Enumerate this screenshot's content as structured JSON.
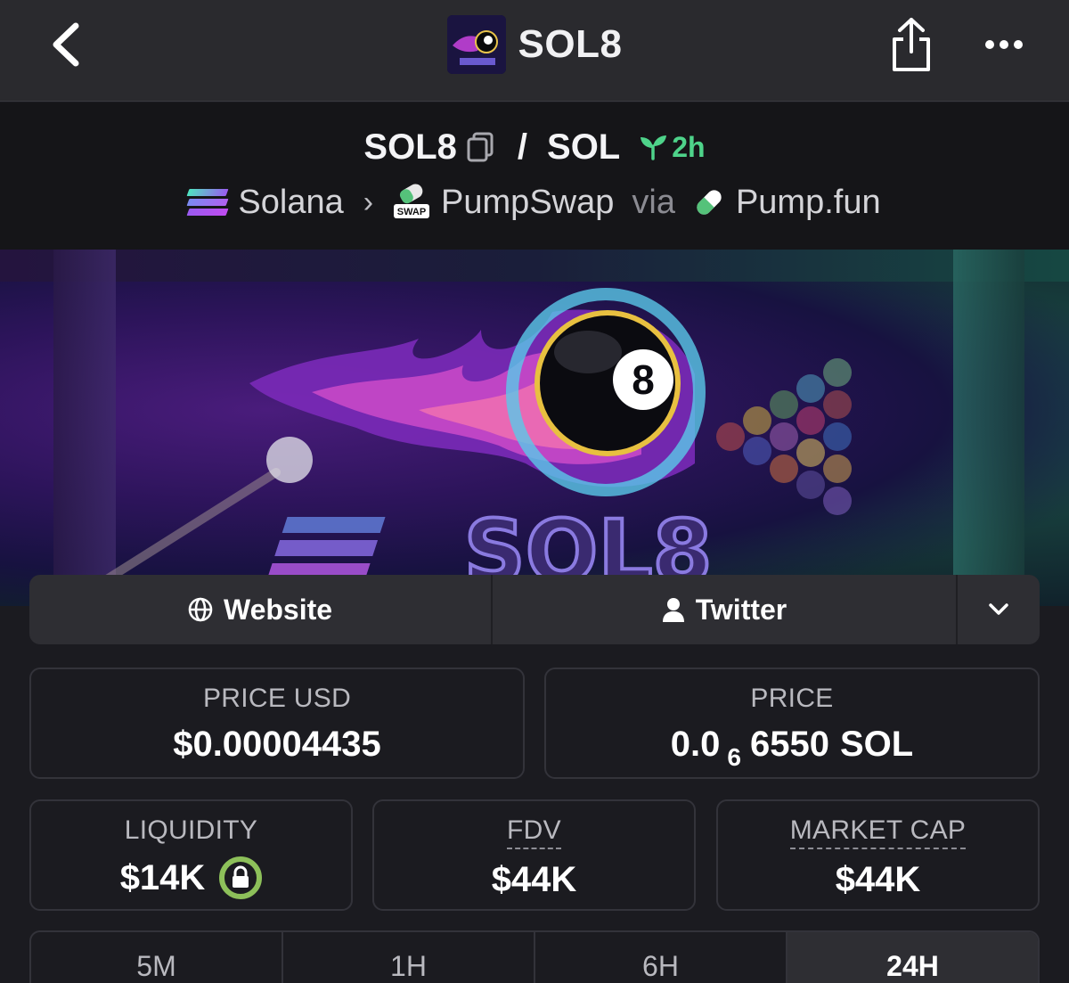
{
  "nav": {
    "title": "SOL8",
    "thumb_text": "SOL8"
  },
  "pair": {
    "base": "SOL8",
    "slash": "/",
    "quote": "SOL",
    "age": "2h",
    "chain": "Solana",
    "dex": "PumpSwap",
    "dex_badge": "SWAP",
    "via": "via",
    "launchpad": "Pump.fun"
  },
  "banner": {
    "ball_number": "8",
    "wordmark": "SOL8"
  },
  "social": {
    "website_label": "Website",
    "twitter_label": "Twitter"
  },
  "stats": {
    "price_usd": {
      "label": "PRICE USD",
      "value": "$0.00004435"
    },
    "price": {
      "label": "PRICE",
      "prefix": "0.0",
      "zeros": "6",
      "digits": "6550",
      "unit": "SOL"
    },
    "liquidity": {
      "label": "LIQUIDITY",
      "value": "$14K"
    },
    "fdv": {
      "label": "FDV",
      "value": "$44K"
    },
    "market_cap": {
      "label": "MARKET CAP",
      "value": "$44K"
    }
  },
  "timeframes": [
    {
      "label": "5M",
      "active": false
    },
    {
      "label": "1H",
      "active": false
    },
    {
      "label": "6H",
      "active": false
    },
    {
      "label": "24H",
      "active": true
    }
  ],
  "colors": {
    "accent_green": "#4ed38a",
    "lock_green": "#8dc05a",
    "background": "#1b1b20",
    "topbar": "#2a2a2e"
  }
}
